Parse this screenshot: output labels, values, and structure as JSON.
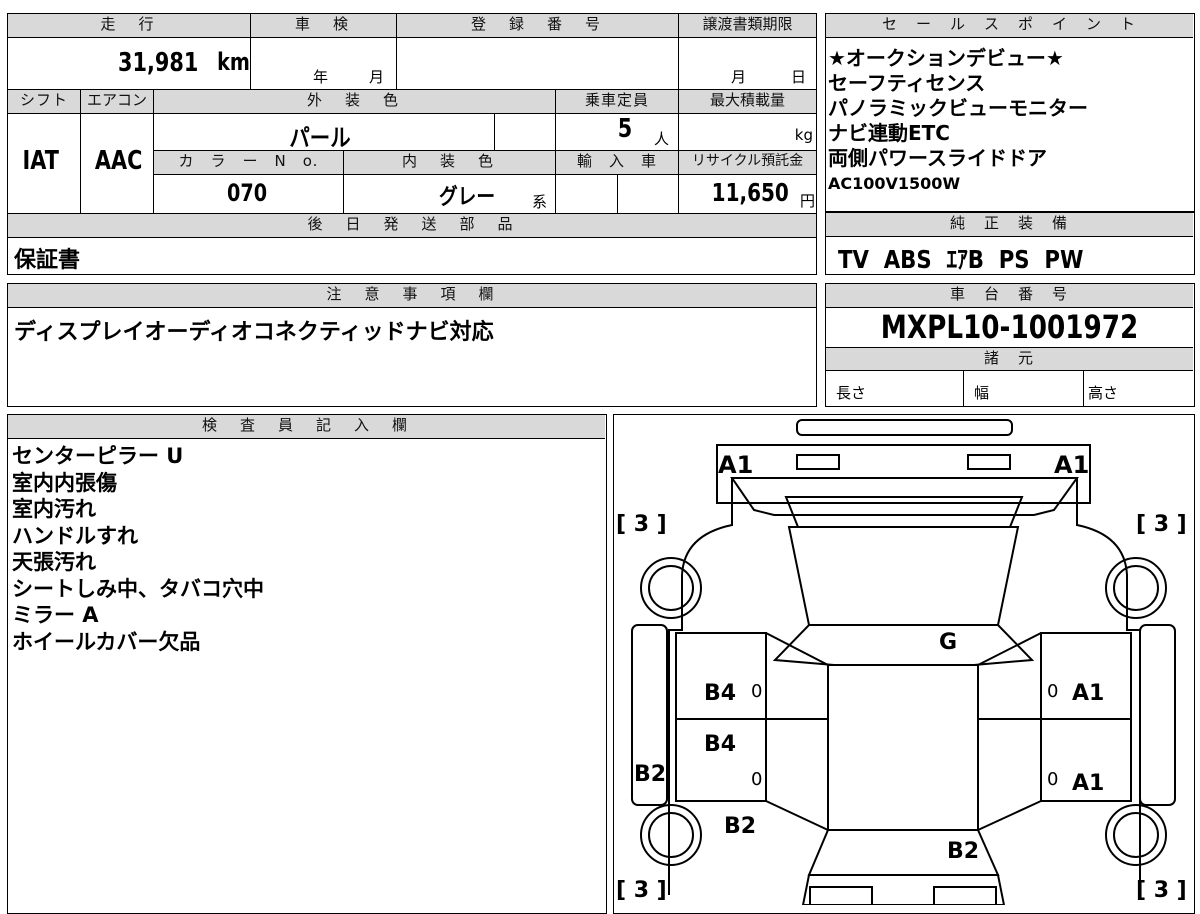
{
  "top_table": {
    "mileage_header": "走　行",
    "mileage_value": "31,981",
    "mileage_unit": "km",
    "shaken_header": "車　検",
    "shaken_year_unit": "年",
    "shaken_month_unit": "月",
    "reg_header": "登　録　番　号",
    "transfer_header": "譲渡書類期限",
    "transfer_month_unit": "月",
    "transfer_day_unit": "日",
    "shift_header": "シフト",
    "shift_value": "IAT",
    "ac_header": "エアコン",
    "ac_value": "AAC",
    "exterior_header": "外　装　色",
    "exterior_value": "パール",
    "capacity_header": "乗車定員",
    "capacity_value": "5",
    "capacity_unit": "人",
    "load_header": "最大積載量",
    "load_unit": "kg",
    "color_no_header": "カ　ラ　ー　N　o.",
    "color_no_value": "070",
    "interior_header": "内　装　色",
    "interior_value": "グレー",
    "interior_unit": "系",
    "import_header": "輸　入　車",
    "recycle_header": "リサイクル預託金",
    "recycle_value": "11,650",
    "recycle_unit": "円",
    "parts_header": "後　日　発　送　部　品",
    "parts_value": "保証書"
  },
  "sales_points": {
    "header": "セ　ー　ル　ス　ポ　イ　ン　ト",
    "lines": [
      "★オークションデビュー★",
      "セーフティセンス",
      "パノラミックビューモニター",
      "ナビ連動ETC",
      "両側パワースライドドア",
      "AC100V1500W"
    ]
  },
  "equipment": {
    "header": "純　正　装　備",
    "value": "TV  ABS  ｴｱB  PS  PW"
  },
  "notes": {
    "header": "注　意　事　項　欄",
    "value": "ディスプレイオーディオコネクティッドナビ対応"
  },
  "chassis": {
    "header": "車　台　番　号",
    "value": "MXPL10-1001972"
  },
  "specs": {
    "header": "諸　元",
    "length": "長さ",
    "width": "幅",
    "height": "高さ"
  },
  "inspector": {
    "header": "検　査　員　記　入　欄",
    "lines": [
      "センターピラー U",
      "室内内張傷",
      "室内汚れ",
      "ハンドルすれ",
      "天張汚れ",
      "シートしみ中、タバコ穴中",
      "ミラー A",
      "ホイールカバー欠品"
    ]
  },
  "diagram": {
    "labels": {
      "a1_top_left": "A1",
      "a1_top_right": "A1",
      "tire_top_left": "[ 3 ]",
      "tire_top_right": "[ 3 ]",
      "tire_bottom_left": "[ 3 ]",
      "tire_bottom_right": "[ 3 ]",
      "g_windshield": "G",
      "b4_front_left": "B4",
      "b4_rear_left": "B4",
      "b2_left_side": "B2",
      "b2_rear_left": "B2",
      "b2_bottom": "B2",
      "a1_front_right": "A1",
      "a1_rear_right": "A1",
      "zero_1": "0",
      "zero_2": "0",
      "zero_3": "0",
      "zero_4": "0"
    }
  }
}
